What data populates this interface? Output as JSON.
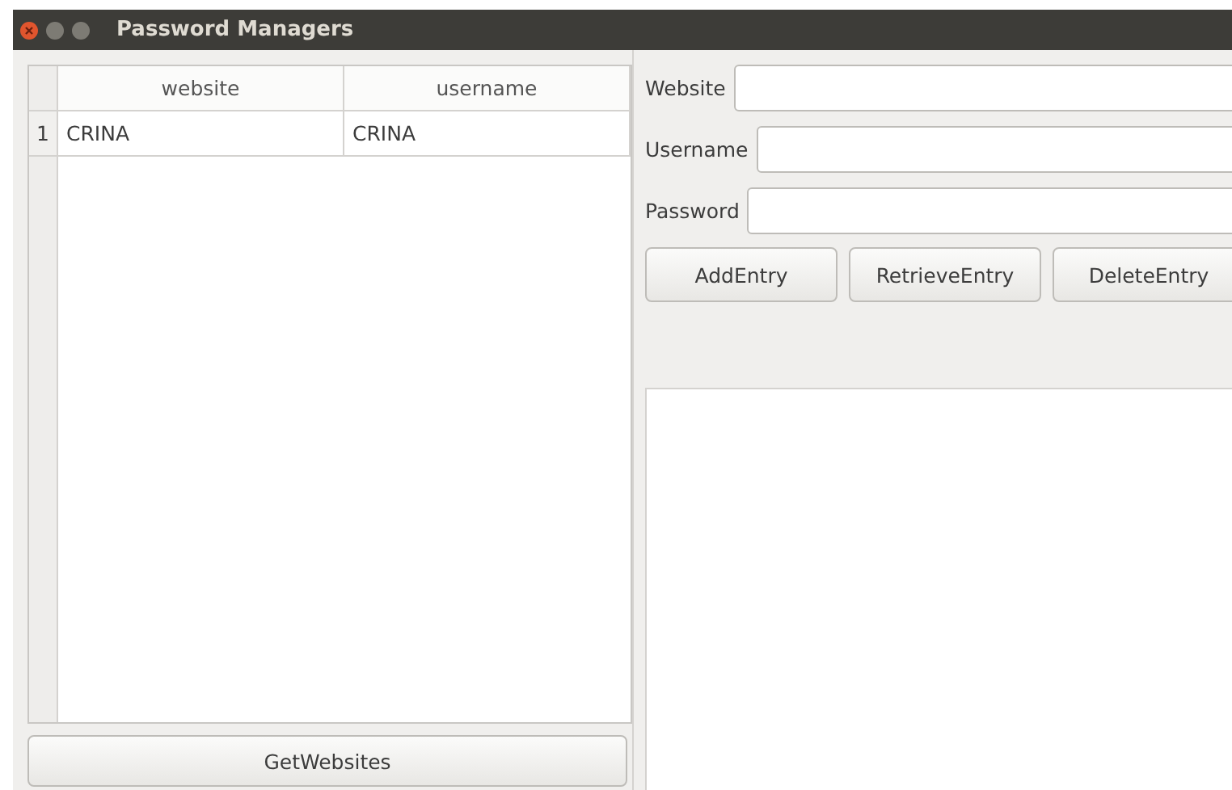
{
  "window": {
    "title": "Password Managers"
  },
  "table": {
    "columns": [
      "website",
      "username"
    ],
    "rows": [
      {
        "number": "1",
        "cells": [
          "CRINA",
          "CRINA"
        ]
      }
    ]
  },
  "get_button": "GetWebsites",
  "form": {
    "fields": [
      {
        "label": "Website"
      },
      {
        "label": "Username"
      },
      {
        "label": "Password"
      }
    ],
    "buttons": [
      "AddEntry",
      "RetrieveEntry",
      "DeleteEntry"
    ]
  }
}
